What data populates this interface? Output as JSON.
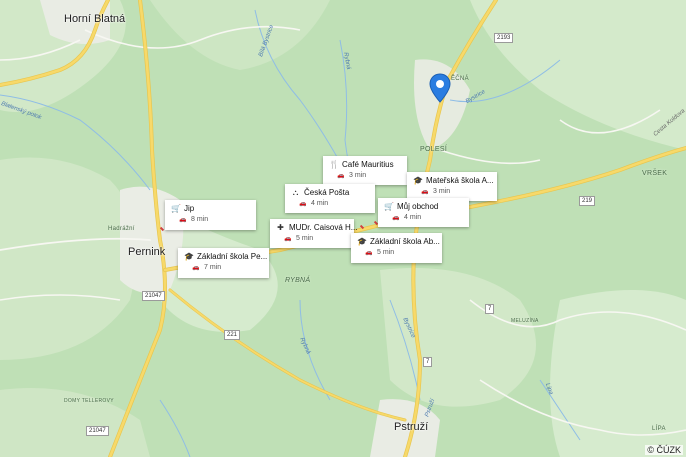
{
  "map": {
    "places": {
      "horni_blatna": "Horní Blatná",
      "pernink": "Pernink",
      "pstruzi": "Pstruží",
      "hadrazni": "Hadrážní",
      "polesi": "POLESÍ",
      "vrsek": "VRŠEK",
      "rybna": "RYBNÁ",
      "domy_tellerovy": "DOMY TELLEROVY",
      "hrebecna": "ĚČNÁ",
      "lipa": "LÍPA",
      "meluzina": "MELUZÍNA"
    },
    "water": {
      "bila_bystrice": "Bílá Bystrice",
      "bystrice": "Bystrice",
      "blatensky_potok": "Blatenský potok",
      "rybna_creek": "Rybná",
      "cesta_koldova": "Cesta Koldova",
      "bystrice_2": "Bystrice",
      "rybna_small": "Rybná",
      "pstruzi_creek": "Pstruží",
      "lipa_creek": "Lípa"
    },
    "road_shields": [
      "2193",
      "219",
      "21047",
      "221",
      "7",
      "7",
      "21047"
    ],
    "copyright": "© ČÚZK"
  },
  "pois": [
    {
      "name": "Café Mauritius",
      "time": "3 min",
      "icon": "restaurant-icon"
    },
    {
      "name": "Mateřská škola A...",
      "time": "3 min",
      "icon": "school-icon"
    },
    {
      "name": "Česká Pošta",
      "time": "4 min",
      "icon": "post-icon"
    },
    {
      "name": "Můj obchod",
      "time": "4 min",
      "icon": "shop-icon"
    },
    {
      "name": "Jip",
      "time": "8 min",
      "icon": "shop-icon"
    },
    {
      "name": "MUDr. Caisová H...",
      "time": "5 min",
      "icon": "medical-icon"
    },
    {
      "name": "Základní škola Ab...",
      "time": "5 min",
      "icon": "school-icon"
    },
    {
      "name": "Základní škola Pe...",
      "time": "7 min",
      "icon": "school-icon"
    }
  ]
}
